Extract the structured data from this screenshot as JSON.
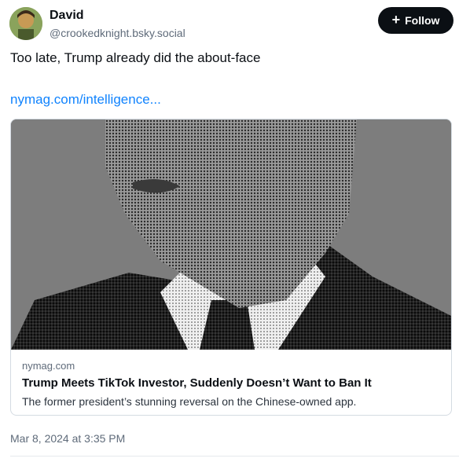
{
  "author": {
    "display_name": "David",
    "handle": "@crookedknight.bsky.social",
    "avatar_icon": "avatar-image"
  },
  "follow_button": {
    "label": "Follow",
    "icon": "plus-icon"
  },
  "post": {
    "text": "Too late, Trump already did the about-face",
    "link_text": "nymag.com/intelligence..."
  },
  "link_card": {
    "image_alt": "halftone-portrait",
    "domain": "nymag.com",
    "title": "Trump Meets TikTok Investor, Suddenly Doesn’t Want to Ban It",
    "description": "The former president’s stunning reversal on the Chinese-owned app."
  },
  "timestamp": "Mar 8, 2024 at 3:35 PM",
  "colors": {
    "link": "#1083fe",
    "button_bg": "#0b0f14",
    "muted_text": "#5f6b7a"
  }
}
